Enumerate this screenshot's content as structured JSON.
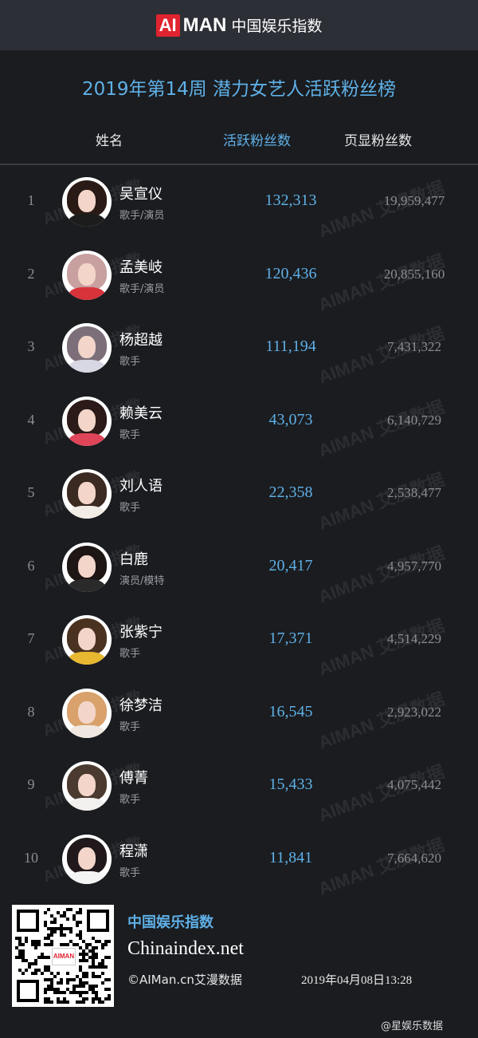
{
  "header": {
    "logo_ai": "AI",
    "logo_man": "MAN",
    "logo_sub": "中国娱乐指数"
  },
  "title": "2019年第14周 潜力女艺人活跃粉丝榜",
  "columns": {
    "name": "姓名",
    "active": "活跃粉丝数",
    "page": "页显粉丝数"
  },
  "watermark": {
    "left": "AIMAN 乐指数",
    "right": "AIMAN 艾漫数据"
  },
  "rows": [
    {
      "rank": "1",
      "name": "吴宣仪",
      "role": "歌手/演员",
      "active": "132,313",
      "page": "19,959,477"
    },
    {
      "rank": "2",
      "name": "孟美岐",
      "role": "歌手/演员",
      "active": "120,436",
      "page": "20,855,160"
    },
    {
      "rank": "3",
      "name": "杨超越",
      "role": "歌手",
      "active": "111,194",
      "page": "7,431,322"
    },
    {
      "rank": "4",
      "name": "赖美云",
      "role": "歌手",
      "active": "43,073",
      "page": "6,140,729"
    },
    {
      "rank": "5",
      "name": "刘人语",
      "role": "歌手",
      "active": "22,358",
      "page": "2,538,477"
    },
    {
      "rank": "6",
      "name": "白鹿",
      "role": "演员/模特",
      "active": "20,417",
      "page": "4,957,770"
    },
    {
      "rank": "7",
      "name": "张紫宁",
      "role": "歌手",
      "active": "17,371",
      "page": "4,514,229"
    },
    {
      "rank": "8",
      "name": "徐梦洁",
      "role": "歌手",
      "active": "16,545",
      "page": "2,923,022"
    },
    {
      "rank": "9",
      "name": "傅菁",
      "role": "歌手",
      "active": "15,433",
      "page": "4,075,442"
    },
    {
      "rank": "10",
      "name": "程潇",
      "role": "歌手",
      "active": "11,841",
      "page": "7,664,620"
    }
  ],
  "avatar_colors": [
    {
      "hair": "#2a1a16",
      "body": "#1c1c1c"
    },
    {
      "hair": "#c8a0a0",
      "body": "#d8323a"
    },
    {
      "hair": "#7d6f7a",
      "body": "#d8d8e4"
    },
    {
      "hair": "#2b1a17",
      "body": "#e04458"
    },
    {
      "hair": "#3a2a22",
      "body": "#f2ece6"
    },
    {
      "hair": "#1e1614",
      "body": "#2a2a2a"
    },
    {
      "hair": "#4a3220",
      "body": "#e7b830"
    },
    {
      "hair": "#d9a16b",
      "body": "#f0e8e0"
    },
    {
      "hair": "#4a3a30",
      "body": "#f2f0ee"
    },
    {
      "hair": "#20181a",
      "body": "#f4f4f4"
    }
  ],
  "footer": {
    "qr_logo": "AIMAN",
    "brand": "中国娱乐指数",
    "site": "Chinaindex.net",
    "copyright": "©AIMan.cn艾漫数据",
    "date": "2019年04月08日13:28",
    "weibo": "@星娱乐数据"
  }
}
